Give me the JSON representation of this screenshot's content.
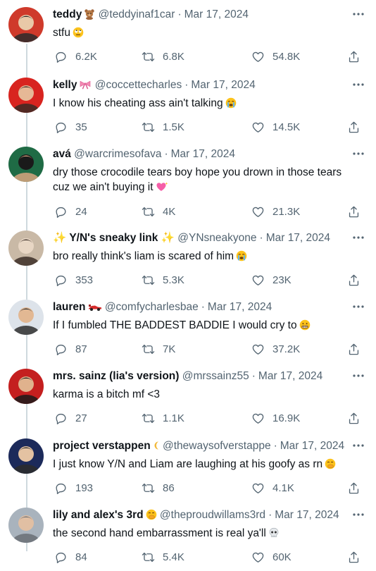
{
  "tweets": [
    {
      "name": "teddy",
      "name_emoji": "bear-emoji",
      "handle": "@teddyinaf1car",
      "date": "Mar 17, 2024",
      "text": "stfu",
      "text_emoji": "rolling-eyes-emoji",
      "replies": "6.2K",
      "retweets": "6.8K",
      "likes": "54.8K",
      "avatar_colors": [
        "#cf3a2b",
        "#2b2b2b",
        "#e9c9a8"
      ]
    },
    {
      "name": "kelly",
      "name_emoji": "ribbon-emoji",
      "handle": "@coccettecharles",
      "date": "Mar 17, 2024",
      "text": "I know his cheating ass ain't talking",
      "text_emoji": "loudly-crying-emoji",
      "replies": "35",
      "retweets": "1.5K",
      "likes": "14.5K",
      "avatar_colors": [
        "#d8241f",
        "#3a2a24",
        "#e6b896"
      ]
    },
    {
      "name": "avá",
      "name_emoji": "",
      "handle": "@warcrimesofava",
      "date": "Mar 17, 2024",
      "text": "dry those crocodile tears boy hope you drown in those tears cuz we ain't buying it",
      "text_emoji": "sparkling-heart-emoji",
      "replies": "24",
      "retweets": "4K",
      "likes": "21.3K",
      "avatar_colors": [
        "#1f6b45",
        "#d9a57f",
        "#1a1a1a"
      ]
    },
    {
      "name_prefix": "✨",
      "name": "Y/N's sneaky link",
      "name_suffix": "✨",
      "handle": "@YNsneakyone",
      "date": "Mar 17, 2024",
      "text": "bro really think's liam is scared of him",
      "text_emoji": "loudly-crying-emoji",
      "replies": "353",
      "retweets": "5.3K",
      "likes": "23K",
      "avatar_colors": [
        "#c9b9a6",
        "#3b2d26",
        "#e8d6c4"
      ]
    },
    {
      "name": "lauren",
      "name_emoji": "race-car-emoji",
      "handle": "@comfycharlesbae",
      "date": "Mar 17, 2024",
      "text": "If I fumbled THE BADDEST BADDIE I would cry to",
      "text_emoji": "grimacing-emoji",
      "replies": "87",
      "retweets": "7K",
      "likes": "37.2K",
      "avatar_colors": [
        "#dde3ea",
        "#2e2e2e",
        "#e2b893"
      ]
    },
    {
      "name": "mrs. sainz (lia's version)",
      "name_emoji": "",
      "handle": "@mrssainz55",
      "date": "Mar 17, 2024",
      "text": "karma is a bitch mf <3",
      "text_emoji": "",
      "replies": "27",
      "retweets": "1.1K",
      "likes": "16.9K",
      "avatar_colors": [
        "#c41f1f",
        "#1b1b1b",
        "#e0b28d"
      ]
    },
    {
      "name": "project verstappen",
      "name_emoji": "moon-emoji",
      "handle": "@thewaysofverstappe",
      "date": "Mar 17, 2024",
      "text": "I just know Y/N and Liam are laughing at his goofy as rn",
      "text_emoji": "hand-over-mouth-emoji",
      "replies": "193",
      "retweets": "86",
      "likes": "4.1K",
      "avatar_colors": [
        "#1c2a5a",
        "#2b2b2b",
        "#e4c2a2"
      ]
    },
    {
      "name": "lily and alex's 3rd",
      "name_emoji": "hand-over-mouth-emoji",
      "handle": "@theproudwillams3rd",
      "date": "Mar 17, 2024",
      "text": "the second hand embarrassment is real ya'll",
      "text_emoji": "skull-emoji",
      "replies": "84",
      "retweets": "5.4K",
      "likes": "60K",
      "avatar_colors": [
        "#a9b3bd",
        "#6a6f75",
        "#e1bfa3"
      ]
    }
  ],
  "colors": {
    "text": "#0f1419",
    "meta": "#536471",
    "thread_line": "#cfd9de"
  },
  "icons": [
    "reply-icon",
    "retweet-icon",
    "like-icon",
    "share-icon",
    "more-icon"
  ]
}
